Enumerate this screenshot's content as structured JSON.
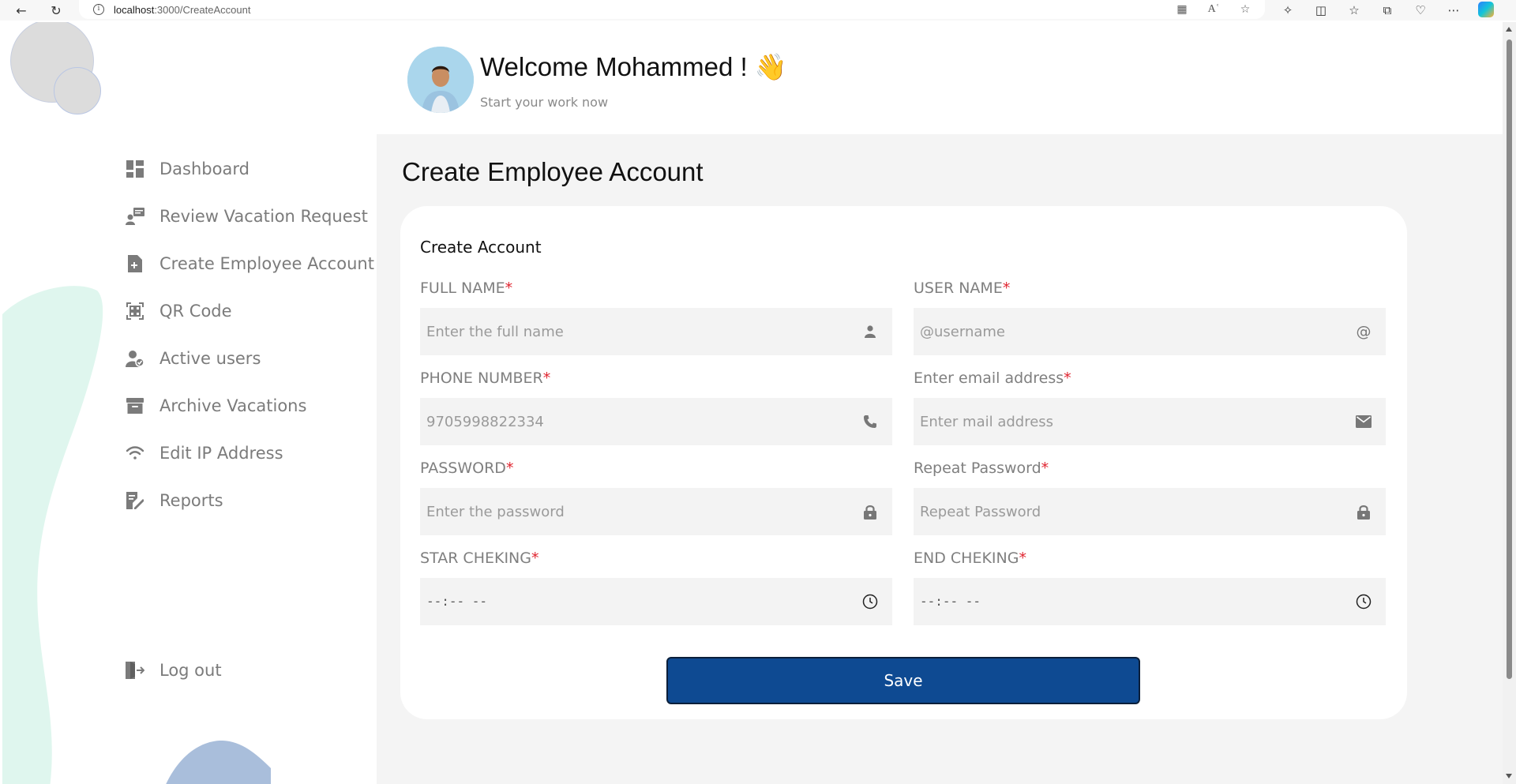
{
  "browser": {
    "url_host": "localhost",
    "url_rest": ":3000/CreateAccount"
  },
  "header": {
    "welcome": "Welcome Mohammed ! 👋",
    "subtitle": "Start your work now"
  },
  "sidebar": {
    "items": [
      {
        "label": "Dashboard",
        "icon": "dashboard-icon"
      },
      {
        "label": "Review Vacation Request",
        "icon": "review-request-icon"
      },
      {
        "label": "Create Employee Account",
        "icon": "create-account-icon"
      },
      {
        "label": "QR Code",
        "icon": "qr-code-icon"
      },
      {
        "label": "Active users",
        "icon": "active-users-icon"
      },
      {
        "label": "Archive Vacations",
        "icon": "archive-icon"
      },
      {
        "label": "Edit IP Address",
        "icon": "wifi-icon"
      },
      {
        "label": "Reports",
        "icon": "reports-icon"
      }
    ],
    "logout": "Log out"
  },
  "main": {
    "title": "Create Employee Account",
    "card_title": "Create Account",
    "fields": {
      "full_name": {
        "label": "FULL NAME",
        "placeholder": "Enter the full name"
      },
      "user_name": {
        "label": "USER NAME",
        "placeholder": "@username"
      },
      "phone": {
        "label": "PHONE NUMBER",
        "placeholder": "9705998822334"
      },
      "email": {
        "label": "Enter email address",
        "placeholder": "Enter mail address"
      },
      "password": {
        "label": "PASSWORD",
        "placeholder": "Enter the password"
      },
      "repeat_password": {
        "label": "Repeat Password",
        "placeholder": "Repeat Password"
      },
      "start_checking": {
        "label": "STAR CHEKING",
        "value": "--:-- --"
      },
      "end_checking": {
        "label": "END CHEKING",
        "value": "--:-- --"
      }
    },
    "required_mark": "*",
    "save_label": "Save"
  },
  "colors": {
    "accent": "#0e4a92",
    "required": "#e0242f",
    "main_bg": "#f4f4f4"
  }
}
